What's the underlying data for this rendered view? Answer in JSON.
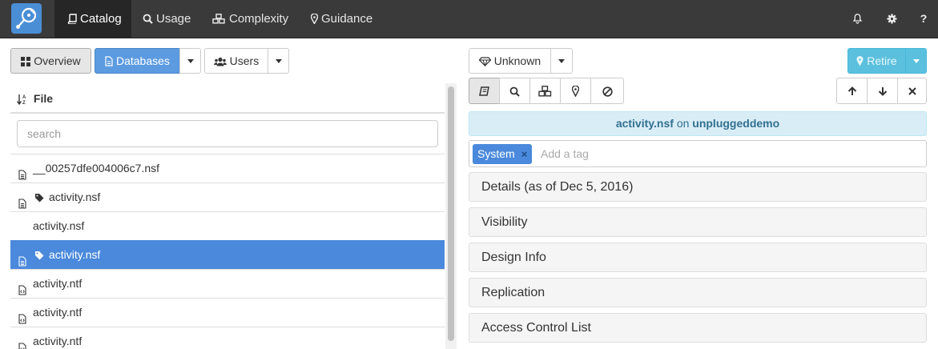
{
  "navbar": {
    "items": [
      {
        "label": "Catalog",
        "icon": "book-icon",
        "active": true
      },
      {
        "label": "Usage",
        "icon": "search-icon"
      },
      {
        "label": "Complexity",
        "icon": "cubes-icon"
      },
      {
        "label": "Guidance",
        "icon": "map-marker-icon"
      }
    ],
    "right": {
      "bell": "bell-icon",
      "gear": "gear-icon",
      "help": "?"
    }
  },
  "toolbar": {
    "overview_label": "Overview",
    "databases_label": "Databases",
    "users_label": "Users"
  },
  "file_panel": {
    "header": "File",
    "search_placeholder": "search",
    "files": [
      {
        "name": "__00257dfe004006c7.nsf",
        "icon": "file-icon",
        "tagged": false,
        "selected": false
      },
      {
        "name": "activity.nsf",
        "icon": "file-icon",
        "tagged": true,
        "selected": false
      },
      {
        "name": "activity.nsf",
        "icon": "",
        "tagged": false,
        "selected": false
      },
      {
        "name": "activity.nsf",
        "icon": "file-icon",
        "tagged": true,
        "selected": true
      },
      {
        "name": "activity.ntf",
        "icon": "file-code-icon",
        "tagged": false,
        "selected": false
      },
      {
        "name": "activity.ntf",
        "icon": "file-code-icon",
        "tagged": false,
        "selected": false
      },
      {
        "name": "activity.ntf",
        "icon": "file-code-icon",
        "tagged": false,
        "selected": false
      }
    ]
  },
  "detail": {
    "status_label": "Unknown",
    "retire_label": "Retire",
    "info": {
      "file": "activity.nsf",
      "on": "on",
      "server": "unpluggeddemo"
    },
    "tags": [
      {
        "label": "System",
        "remove": "×"
      }
    ],
    "tag_placeholder": "Add a tag",
    "sections": [
      "Details (as of Dec 5, 2016)",
      "Visibility",
      "Design Info",
      "Replication",
      "Access Control List"
    ]
  },
  "colors": {
    "navbar_bg": "#3a3a3a",
    "primary": "#4a89dc",
    "info_bg": "#d9edf7",
    "info_text": "#31708f",
    "retire": "#5bc0de"
  }
}
